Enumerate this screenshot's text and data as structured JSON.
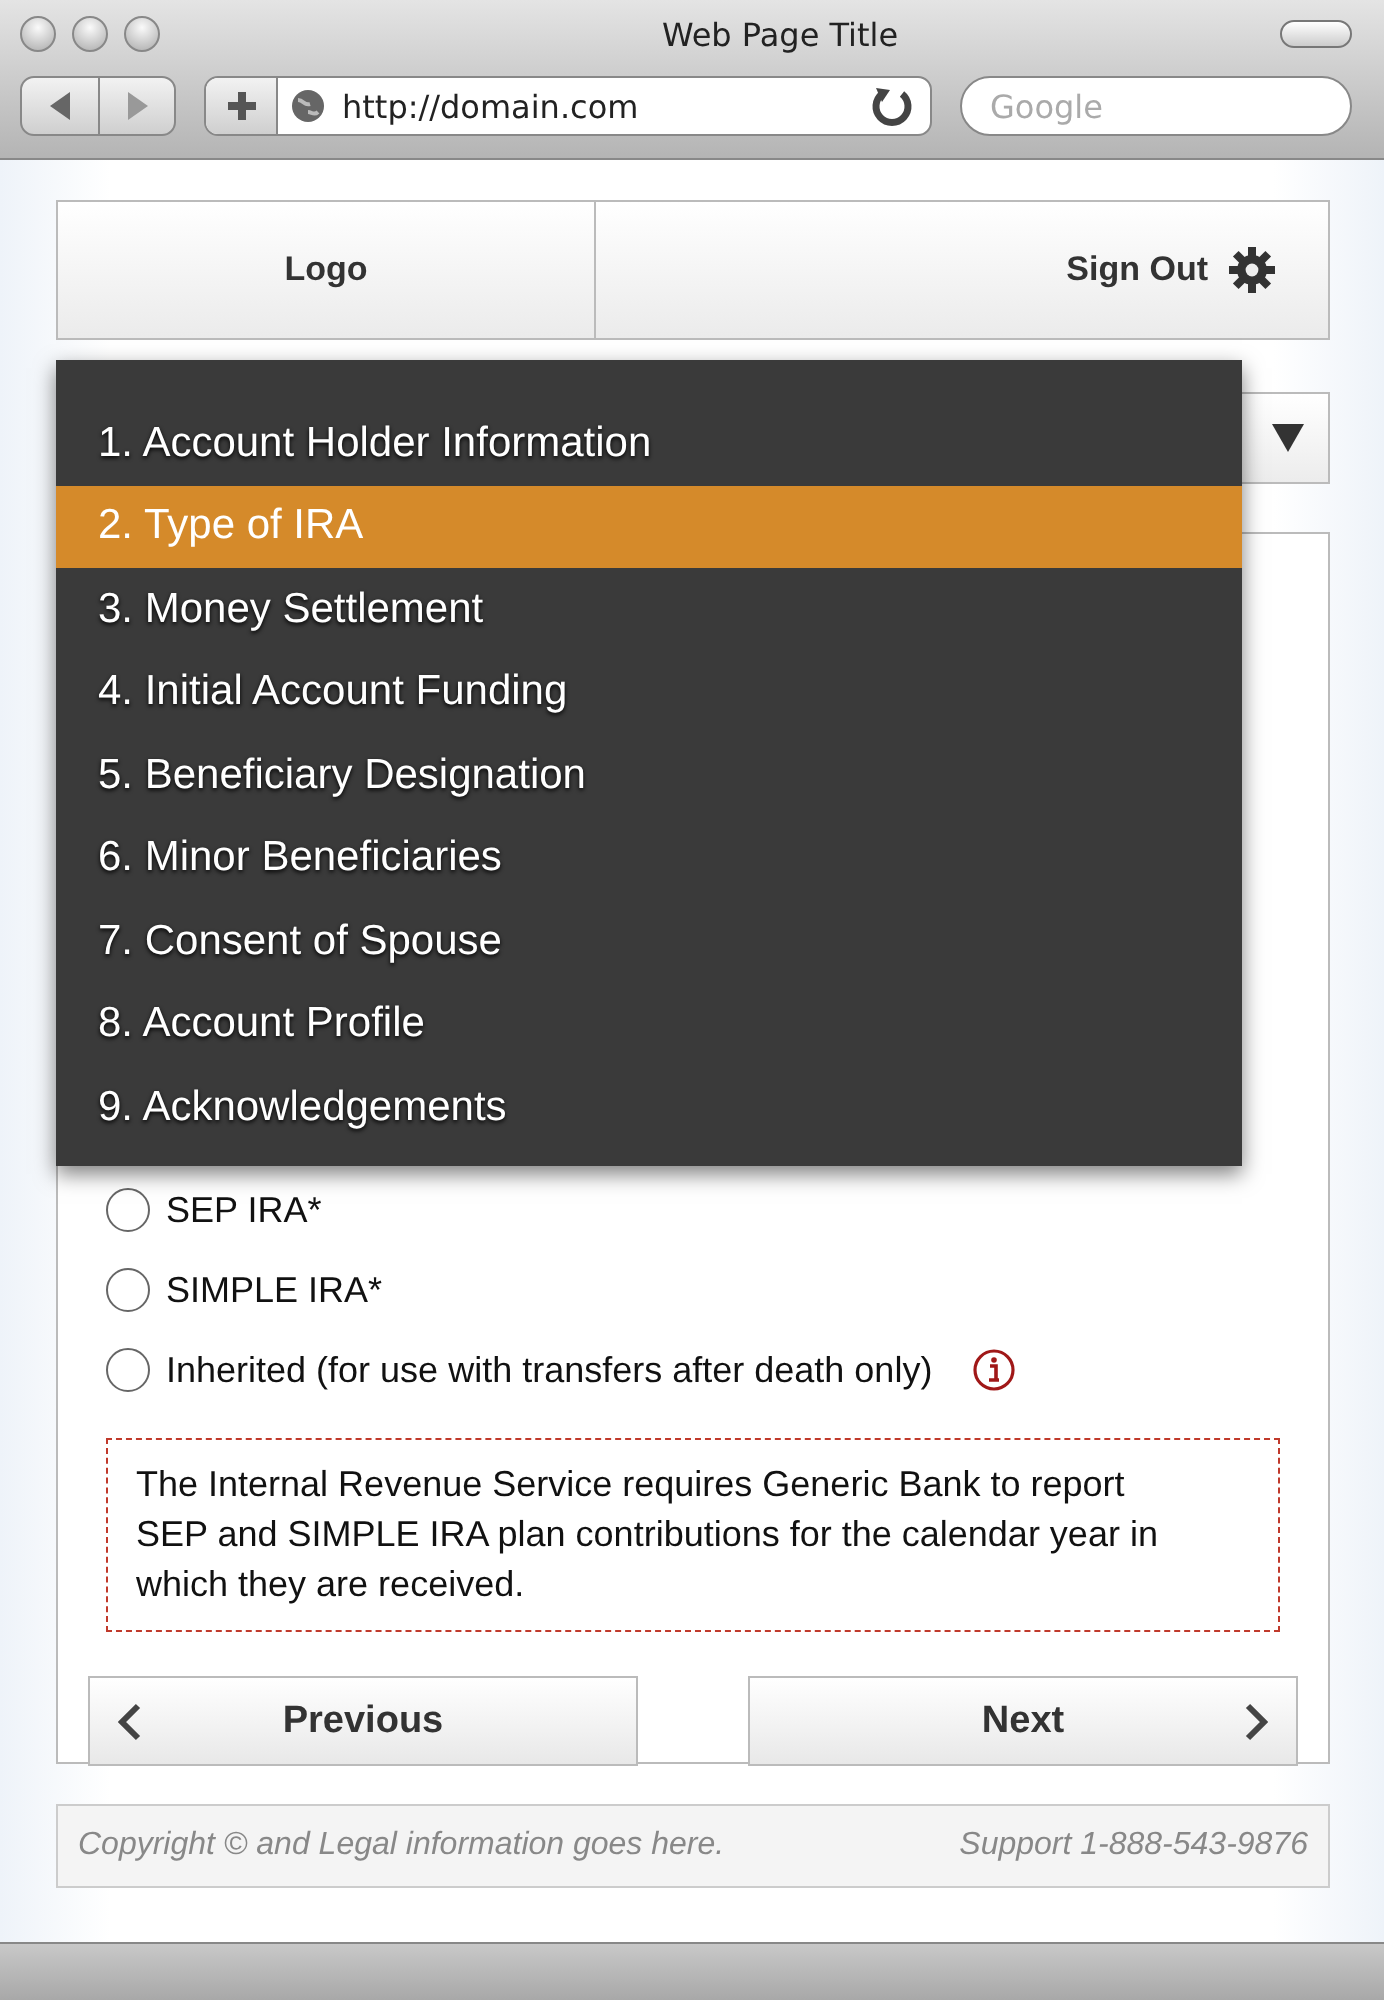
{
  "window": {
    "title": "Web Page Title",
    "url": "http://domain.com",
    "search_placeholder": "Google"
  },
  "header": {
    "logo": "Logo",
    "sign_out": "Sign Out"
  },
  "step_menu": {
    "items": [
      {
        "label": "1. Account Holder Information",
        "selected": false
      },
      {
        "label": "2. Type of IRA",
        "selected": true
      },
      {
        "label": "3. Money Settlement",
        "selected": false
      },
      {
        "label": "4. Initial Account Funding",
        "selected": false
      },
      {
        "label": "5. Beneficiary Designation",
        "selected": false
      },
      {
        "label": "6. Minor Beneficiaries",
        "selected": false
      },
      {
        "label": "7. Consent of Spouse",
        "selected": false
      },
      {
        "label": "8. Account Profile",
        "selected": false
      },
      {
        "label": "9. Acknowledgements",
        "selected": false
      }
    ]
  },
  "ira_options": [
    {
      "label": "SEP IRA*",
      "selected": false
    },
    {
      "label": "SIMPLE IRA*",
      "selected": false
    },
    {
      "label": "Inherited (for use with transfers after death only)",
      "selected": false,
      "info": true
    }
  ],
  "notice": "The Internal Revenue Service requires Generic Bank to report SEP and SIMPLE IRA plan contributions for the calendar year in which they are received.",
  "buttons": {
    "previous": "Previous",
    "next": "Next"
  },
  "footer": {
    "legal": "Copyright © and Legal information goes here.",
    "support": "Support 1-888-543-9876"
  }
}
